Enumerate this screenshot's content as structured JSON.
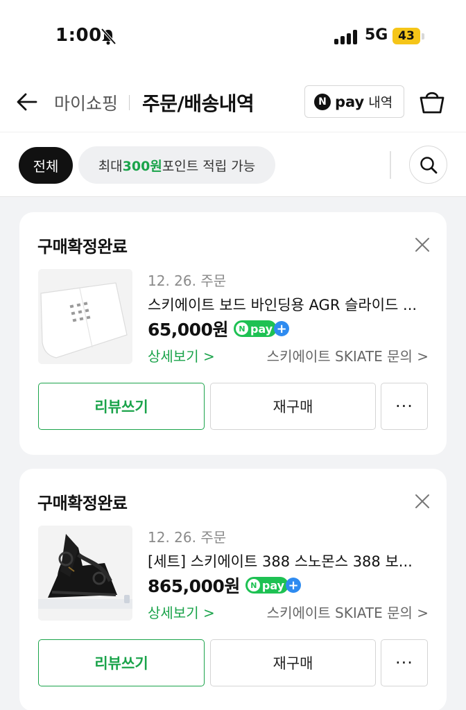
{
  "status_bar": {
    "time": "1:00",
    "network": "5G",
    "battery": "43"
  },
  "header": {
    "breadcrumb": "마이쇼핑",
    "title": "주문/배송내역",
    "npay_logo_n": "N",
    "npay_logo_text": "pay",
    "npay_label": "내역"
  },
  "filter": {
    "all_label": "전체",
    "point_prefix": "최대 ",
    "point_amount": "300원",
    "point_suffix": " 포인트 적립 가능"
  },
  "orders": [
    {
      "status": "구매확정완료",
      "date": "12. 26. 주문",
      "name": "스키에이트 보드 바인딩용 AGR 슬라이드 ...",
      "price": "65,000원",
      "npay_n": "N",
      "npay_text": "pay",
      "npay_plus": "+",
      "detail_link": "상세보기 >",
      "seller_link": "스키에이트 SKIATE 문의 >",
      "review_label": "리뷰쓰기",
      "rebuy_label": "재구매",
      "more_label": "···"
    },
    {
      "status": "구매확정완료",
      "date": "12. 26. 주문",
      "name": "[세트] 스키에이트 388 스노몬스 388 보...",
      "price": "865,000원",
      "npay_n": "N",
      "npay_text": "pay",
      "npay_plus": "+",
      "detail_link": "상세보기 >",
      "seller_link": "스키에이트 SKIATE 문의 >",
      "review_label": "리뷰쓰기",
      "rebuy_label": "재구매",
      "more_label": "···"
    }
  ],
  "colors": {
    "accent_green": "#1aa34a",
    "npay_green": "#1ec153",
    "plus_blue": "#2e8bf0",
    "battery_yellow": "#f5c518"
  }
}
